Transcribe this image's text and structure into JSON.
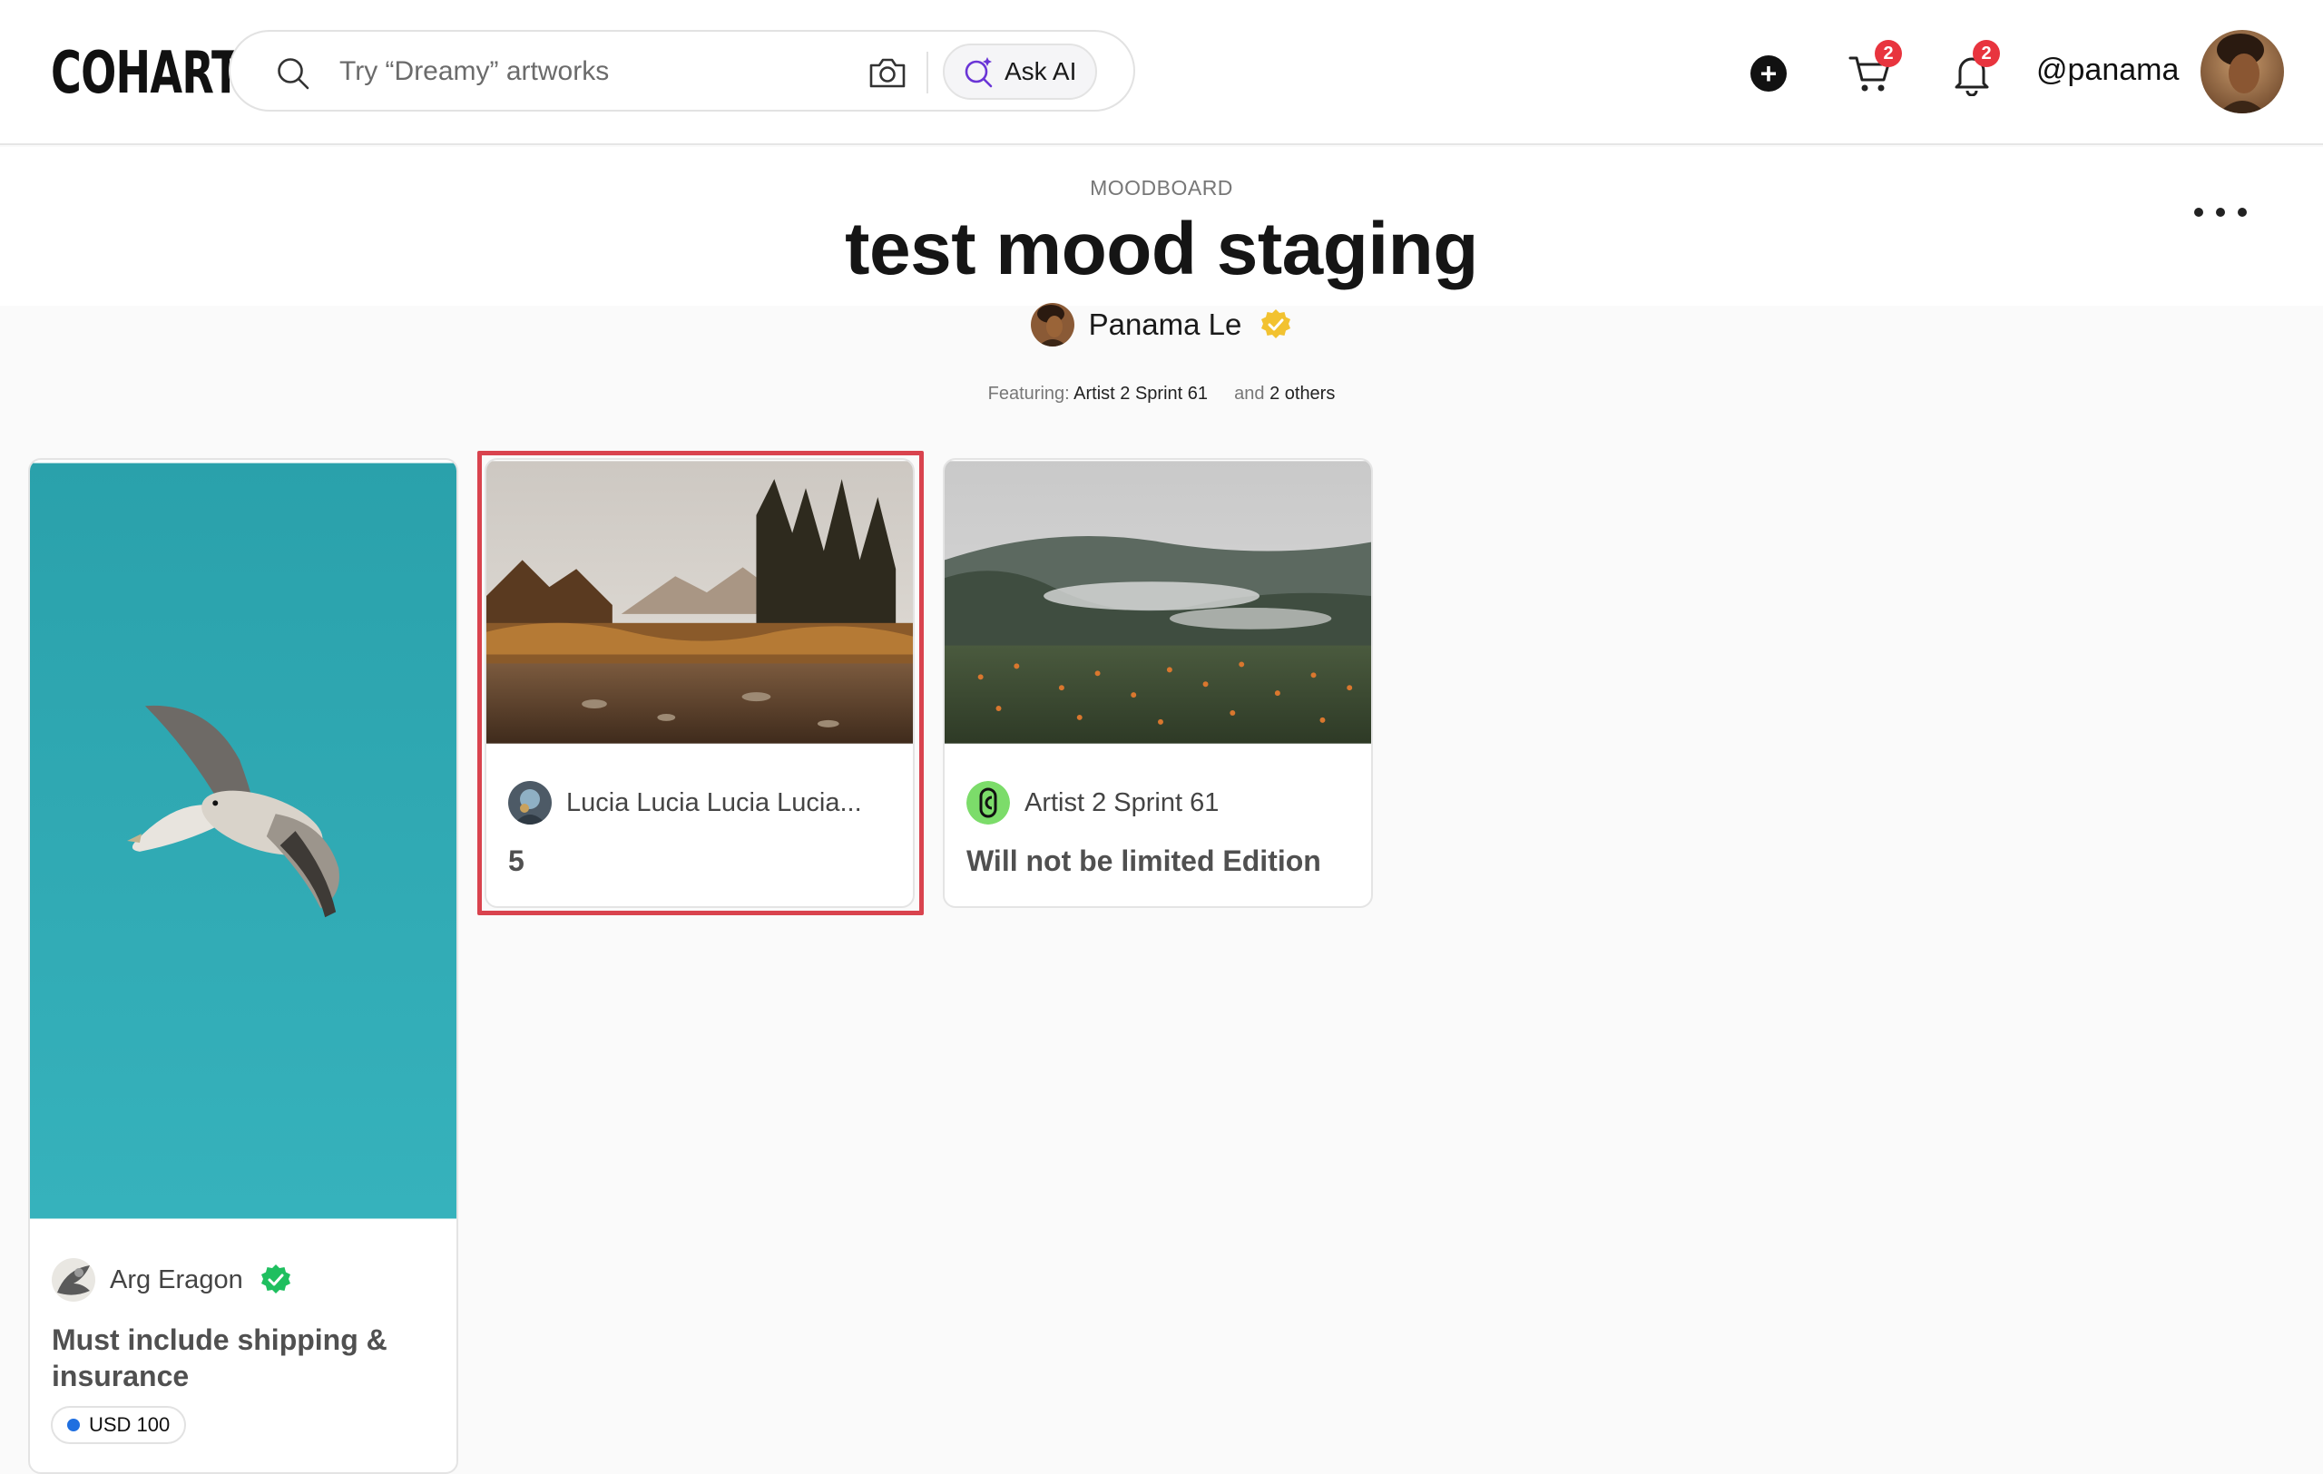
{
  "header": {
    "logo": "COHART",
    "search_placeholder": "Try “Dreamy” artworks",
    "ask_ai_label": "Ask AI",
    "add_label": "+",
    "cart_count": "2",
    "notification_count": "2",
    "username": "@panama"
  },
  "board": {
    "kind_label": "MOODBOARD",
    "title": "test mood staging",
    "owner_name": "Panama Le",
    "featuring_label": "Featuring:",
    "featuring_artist": "Artist 2 Sprint 61",
    "and_label": "and",
    "others_label": "2 others"
  },
  "cards": [
    {
      "artist": "Arg Eragon",
      "caption": "Must include shipping & insurance",
      "price": "USD 100"
    },
    {
      "artist": "Lucia Lucia Lucia Lucia...",
      "caption": "5"
    },
    {
      "artist": "Artist 2 Sprint 61",
      "caption": "Will not be limited Edition"
    }
  ],
  "colors": {
    "accent_red": "#e8343e",
    "selection": "#d9434e",
    "verified_gold": "#f2c230",
    "verified_green": "#1fbf5f",
    "price_dot": "#1f6fe0"
  }
}
